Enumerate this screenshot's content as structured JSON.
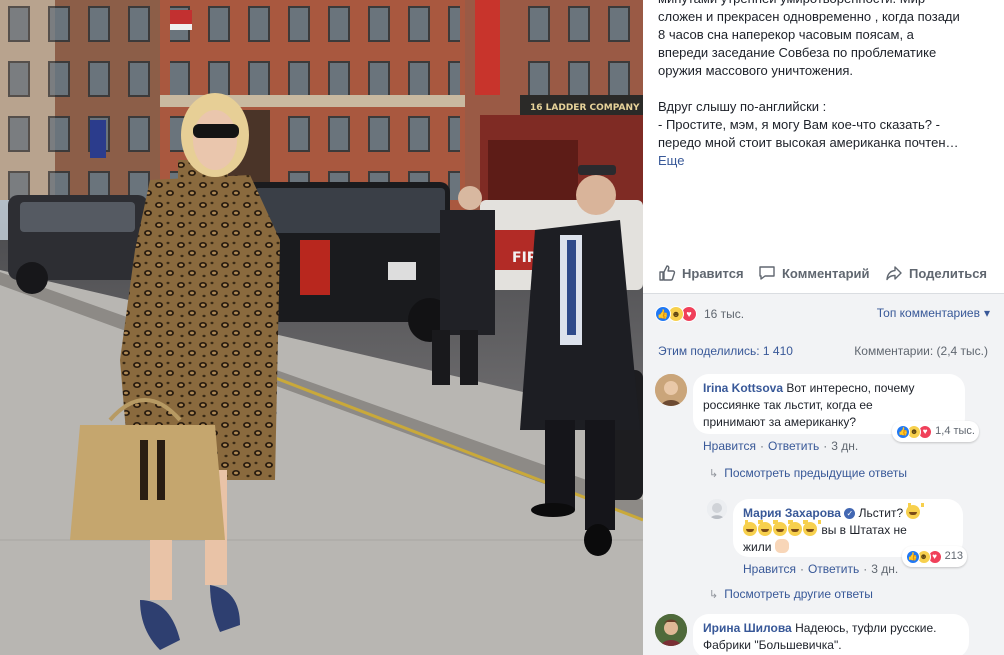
{
  "post": {
    "lines": [
      "минутами утренней умиротворенности. Мир",
      "сложен и прекрасен одновременно , когда позади",
      "8 часов сна наперекор часовым поясам, а",
      "впереди заседание Совбеза по проблематике",
      "оружия массового уничтожения."
    ],
    "lines2": [
      "Вдруг слышу по-английски :",
      "- Простите, мэм, я могу Вам кое-что сказать? -",
      "передо мной стоит высокая американка почтен…"
    ],
    "more_label": "Еще"
  },
  "actions": {
    "like": "Нравится",
    "comment": "Комментарий",
    "share": "Поделиться"
  },
  "stats": {
    "reactions_count": "16 тыс.",
    "top_comments": "Топ комментариев",
    "shares": "Этим поделились: 1 410",
    "comments": "Комментарии: (2,4 тыс.)"
  },
  "comments": [
    {
      "author": "Irina Kottsova",
      "text1": "Вот интересно, почему",
      "text2": "россиянке так льстит, когда ее",
      "text3": "принимают за американку?",
      "reactions": "1,4 тыс.",
      "like": "Нравится",
      "reply": "Ответить",
      "time": "3 дн."
    },
    {
      "author": "Мария Захарова",
      "text1": "Льстит?",
      "text2": "вы в Штатах не",
      "text3": "жили",
      "reactions": "213",
      "like": "Нравится",
      "reply": "Ответить",
      "time": "3 дн."
    },
    {
      "author": "Ирина Шилова",
      "text1": "Надеюсь, туфли русские.",
      "text2": "Фабрики \"Большевичка\"."
    }
  ],
  "replies": {
    "previous": "Посмотреть предыдущие ответы",
    "other": "Посмотреть другие ответы"
  },
  "photo_signs": {
    "ladder": "16  LADDER  COMPANY",
    "fire": "FIRE"
  },
  "colors": {
    "link": "#385898",
    "grey_bg": "#f2f3f5",
    "like_blue": "#2078f4",
    "love_red": "#f0405a"
  }
}
